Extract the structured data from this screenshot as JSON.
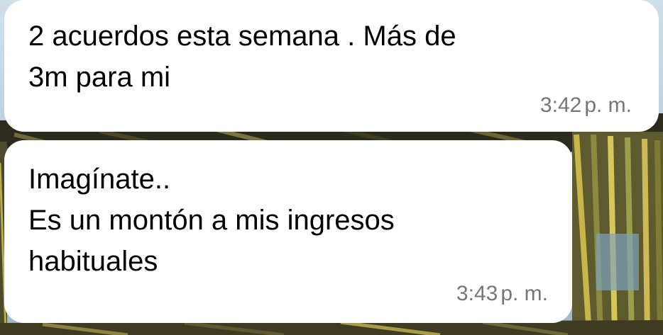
{
  "chat": {
    "messages": [
      {
        "text": "2 acuerdos esta semana . Más de\n3m para mi",
        "time_main": "3:42",
        "time_suffix": "p. m."
      },
      {
        "text": "Imagínate..\nEs un montón a mis ingresos\nhabituales",
        "time_main": "3:43",
        "time_suffix": "p. m."
      }
    ]
  },
  "theme": {
    "bubble_color": "#ffffff",
    "text_color": "#000000",
    "timestamp_color": "#767676",
    "wallpaper": "palm-leaves-photo"
  }
}
